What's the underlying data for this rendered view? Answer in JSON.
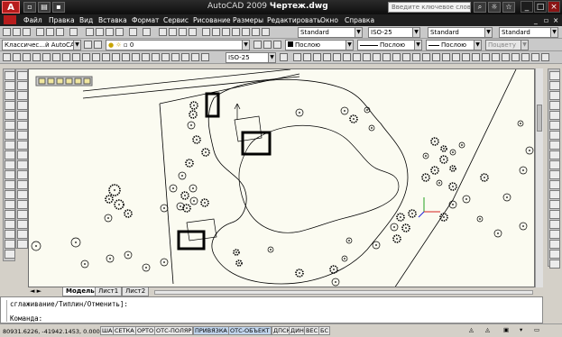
{
  "titlebar": {
    "app_name": "AutoCAD 2009",
    "file_name": "Чертеж.dwg",
    "search_placeholder": "Введите ключевое слово или фр",
    "logo_letter": "A"
  },
  "menu": {
    "items": [
      "Файл",
      "Правка",
      "Вид",
      "Вставка",
      "Формат",
      "Сервис",
      "Рисование",
      "Размеры",
      "Редактировать",
      "Окно",
      "Справка"
    ]
  },
  "toolbar2": {
    "text_style": "Standard",
    "dim_style": "ISO-25",
    "table_style": "Standard",
    "mleader_style": "Standard"
  },
  "toolbar3": {
    "workspace": "Классичес...й AutoCAD",
    "layer": "0",
    "color": "Послою",
    "linetype": "Послою",
    "lineweight": "Послою",
    "plotstyle": "Поцвету"
  },
  "toolbar4": {
    "dim_style": "ISO-25"
  },
  "tabs": [
    "Модель",
    "Лист1",
    "Лист2"
  ],
  "command": {
    "history": "сглаживание/Типлин/Отменить]:",
    "prompt": "Команда:"
  },
  "status": {
    "coords": "80931.6226, -41942.1453, 0.0000",
    "buttons": [
      "ШАГ",
      "СЕТКА",
      "ОРТО",
      "ОТС-ПОЛЯР",
      "ПРИВЯЗКА",
      "ОТС-ОБЪЕКТ",
      "ДПСК",
      "ДИН",
      "ВЕС",
      "БС"
    ]
  },
  "colors": {
    "titlebar": "#141414",
    "canvas": "#fbfbf1",
    "ucs_x": "#d62020",
    "ucs_y": "#20a020"
  }
}
